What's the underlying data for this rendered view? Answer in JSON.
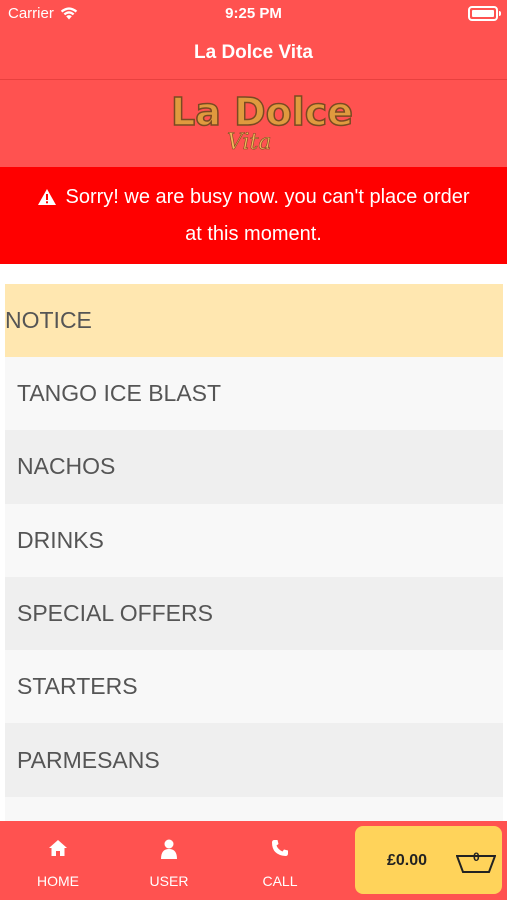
{
  "status_bar": {
    "carrier": "Carrier",
    "time": "9:25 PM"
  },
  "nav": {
    "title": "La Dolce Vita"
  },
  "logo": {
    "main_text": "La Dolce",
    "sub_text": "Vita"
  },
  "alert": {
    "line1": "Sorry! we are busy now. you can't place order",
    "line2": "at this moment."
  },
  "menu": {
    "items": [
      {
        "label": "NOTICE"
      },
      {
        "label": "TANGO ICE BLAST"
      },
      {
        "label": "NACHOS"
      },
      {
        "label": "DRINKS"
      },
      {
        "label": "SPECIAL OFFERS"
      },
      {
        "label": "STARTERS"
      },
      {
        "label": "PARMESANS"
      },
      {
        "label": ""
      }
    ]
  },
  "tabbar": {
    "home_label": "HOME",
    "user_label": "USER",
    "call_label": "CALL",
    "cart_amount": "£0.00",
    "cart_count": "0"
  },
  "colors": {
    "header": "#ff5250",
    "alert": "#ff0000",
    "notice_row": "#ffe7b0",
    "cart_button": "#ffd35a"
  }
}
